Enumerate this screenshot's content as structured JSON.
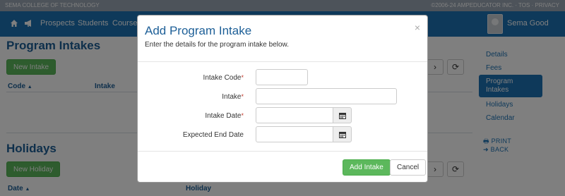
{
  "topstrip": {
    "left": "SEMA COLLEGE OF TECHNOLOGY",
    "right": "©2006-24 AMPEDUCATOR INC. · TOS · PRIVACY"
  },
  "nav": {
    "items": [
      "Prospects",
      "Students",
      "Courses"
    ],
    "username": "Sema Good"
  },
  "page": {
    "intakes_title": "Program Intakes",
    "new_intake_label": "New Intake",
    "intakes_columns": [
      "Code",
      "Intake"
    ],
    "holidays_title": "Holidays",
    "new_holiday_label": "New Holiday",
    "holidays_columns": [
      "Date",
      "Holiday"
    ]
  },
  "sidebar": {
    "items": [
      "Details",
      "Fees",
      "Program Intakes",
      "Holidays",
      "Calendar"
    ],
    "active_index": 2,
    "print_label": "PRINT",
    "back_label": "BACK"
  },
  "modal": {
    "title": "Add Program Intake",
    "subtitle": "Enter the details for the program intake below.",
    "close_glyph": "×",
    "fields": {
      "intake_code": {
        "label": "Intake Code",
        "required": true,
        "value": ""
      },
      "intake": {
        "label": "Intake",
        "required": true,
        "value": ""
      },
      "intake_date": {
        "label": "Intake Date",
        "required": true,
        "value": ""
      },
      "expected_end_date": {
        "label": "Expected End Date",
        "required": false,
        "value": ""
      }
    },
    "required_marker": "*",
    "submit_label": "Add Intake",
    "cancel_label": "Cancel"
  },
  "colors": {
    "brand_blue": "#1d72b4",
    "heading_blue": "#1d5f97",
    "success_green": "#5cb85c"
  },
  "icons": {
    "home": "home-icon",
    "megaphone": "megaphone-icon",
    "refresh": "refresh-icon",
    "chevron_right": "chevron-right-icon",
    "calendar": "calendar-icon",
    "print": "print-icon",
    "back": "arrow-left-icon"
  }
}
